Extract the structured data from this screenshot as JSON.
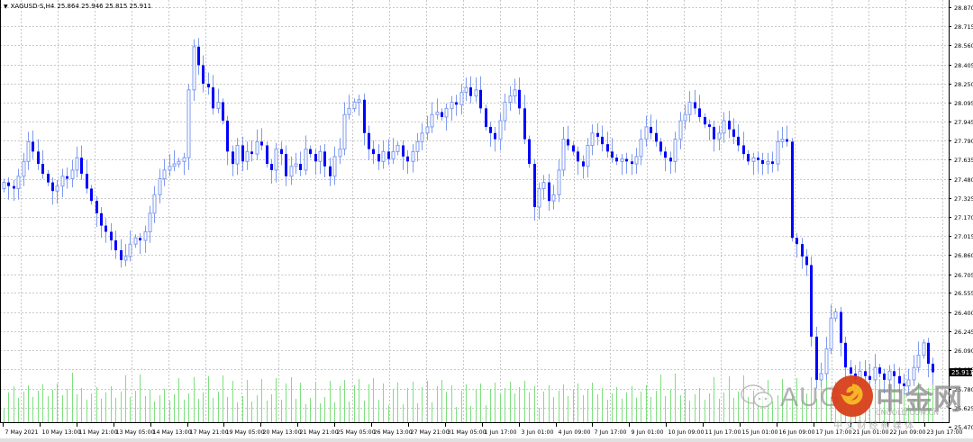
{
  "header": {
    "menu_icon": "triangle-down-icon",
    "symbol": "XAGUSD-S,H4",
    "ohlc": "25.864 25.946 25.815 25.911"
  },
  "watermark": {
    "brand_latin": "AUG",
    "brand_cn": "中金网",
    "domain": "CNGOLD.COM.CN",
    "tagline": "中 文 财 经 新 媒 体",
    "icons": [
      "wechat-icon",
      "cngold-logo-icon"
    ]
  },
  "colors": {
    "bear": "#0000ff",
    "bull_outline": "#7f9bef",
    "grid": "#c8c8c8",
    "volume": "#7ee07e",
    "axis": "#000000"
  },
  "chart_data": {
    "type": "candlestick",
    "title": "XAGUSD-S,H4",
    "current_price_label": "25.911",
    "ylim": [
      25.47,
      28.87
    ],
    "y_ticks": [
      "28.870",
      "28.715",
      "28.560",
      "28.405",
      "28.250",
      "28.095",
      "27.945",
      "27.790",
      "27.635",
      "27.480",
      "27.325",
      "27.170",
      "27.015",
      "26.860",
      "26.705",
      "26.555",
      "26.400",
      "26.245",
      "26.090",
      "25.935",
      "25.780",
      "25.625",
      "25.470"
    ],
    "x_ticks": [
      "7 May 2021",
      "10 May 13:00",
      "11 May 21:00",
      "13 May 05:00",
      "14 May 13:00",
      "17 May 21:00",
      "19 May 05:00",
      "20 May 13:00",
      "21 May 21:00",
      "25 May 05:00",
      "26 May 13:00",
      "27 May 21:00",
      "31 May 05:00",
      "1 Jun 17:00",
      "3 Jun 01:00",
      "4 Jun 09:00",
      "7 Jun 17:00",
      "9 Jun 01:00",
      "10 Jun 09:00",
      "11 Jun 17:00",
      "15 Jun 01:00",
      "16 Jun 09:00",
      "17 Jun 17:00",
      "21 Jun 01:00",
      "22 Jun 09:00",
      "23 Jun 17:00"
    ],
    "first_open": 27.4,
    "closes": [
      27.45,
      27.42,
      27.4,
      27.5,
      27.62,
      27.78,
      27.7,
      27.6,
      27.52,
      27.45,
      27.38,
      27.42,
      27.5,
      27.48,
      27.55,
      27.65,
      27.52,
      27.4,
      27.3,
      27.2,
      27.1,
      27.05,
      26.98,
      26.9,
      26.82,
      26.85,
      26.95,
      27.0,
      26.98,
      27.05,
      27.2,
      27.35,
      27.48,
      27.55,
      27.58,
      27.6,
      27.62,
      27.65,
      28.2,
      28.55,
      28.4,
      28.25,
      28.22,
      28.05,
      28.1,
      27.95,
      27.7,
      27.6,
      27.75,
      27.62,
      27.7,
      27.68,
      27.78,
      27.75,
      27.6,
      27.55,
      27.72,
      27.68,
      27.5,
      27.58,
      27.6,
      27.55,
      27.72,
      27.68,
      27.62,
      27.7,
      27.58,
      27.5,
      27.66,
      27.72,
      28.0,
      28.05,
      28.1,
      28.12,
      27.85,
      27.72,
      27.68,
      27.62,
      27.7,
      27.64,
      27.7,
      27.75,
      27.66,
      27.62,
      27.7,
      27.78,
      27.85,
      27.9,
      28.0,
      28.02,
      27.98,
      28.05,
      28.1,
      28.08,
      28.18,
      28.22,
      28.15,
      28.2,
      28.05,
      27.9,
      27.85,
      27.8,
      27.95,
      28.1,
      28.15,
      28.2,
      28.05,
      27.8,
      27.6,
      27.25,
      27.4,
      27.45,
      27.3,
      27.35,
      27.55,
      27.8,
      27.75,
      27.7,
      27.62,
      27.58,
      27.75,
      27.85,
      27.82,
      27.76,
      27.7,
      27.65,
      27.62,
      27.64,
      27.62,
      27.6,
      27.66,
      27.8,
      27.9,
      27.85,
      27.78,
      27.7,
      27.65,
      27.62,
      27.8,
      27.95,
      28.0,
      28.1,
      28.05,
      27.98,
      27.92,
      27.9,
      27.8,
      27.85,
      27.95,
      27.88,
      27.82,
      27.75,
      27.68,
      27.62,
      27.65,
      27.63,
      27.6,
      27.62,
      27.6,
      27.78,
      27.8,
      27.78,
      27.0,
      26.95,
      26.85,
      26.78,
      26.2,
      25.85,
      25.9,
      26.1,
      26.35,
      26.4,
      26.15,
      25.95,
      25.9,
      25.85,
      25.92,
      25.88,
      25.85,
      25.95,
      25.9,
      25.85,
      25.92,
      25.88,
      25.82,
      25.8,
      25.85,
      25.95,
      26.05,
      26.15,
      25.98,
      25.911
    ],
    "grid": true
  }
}
